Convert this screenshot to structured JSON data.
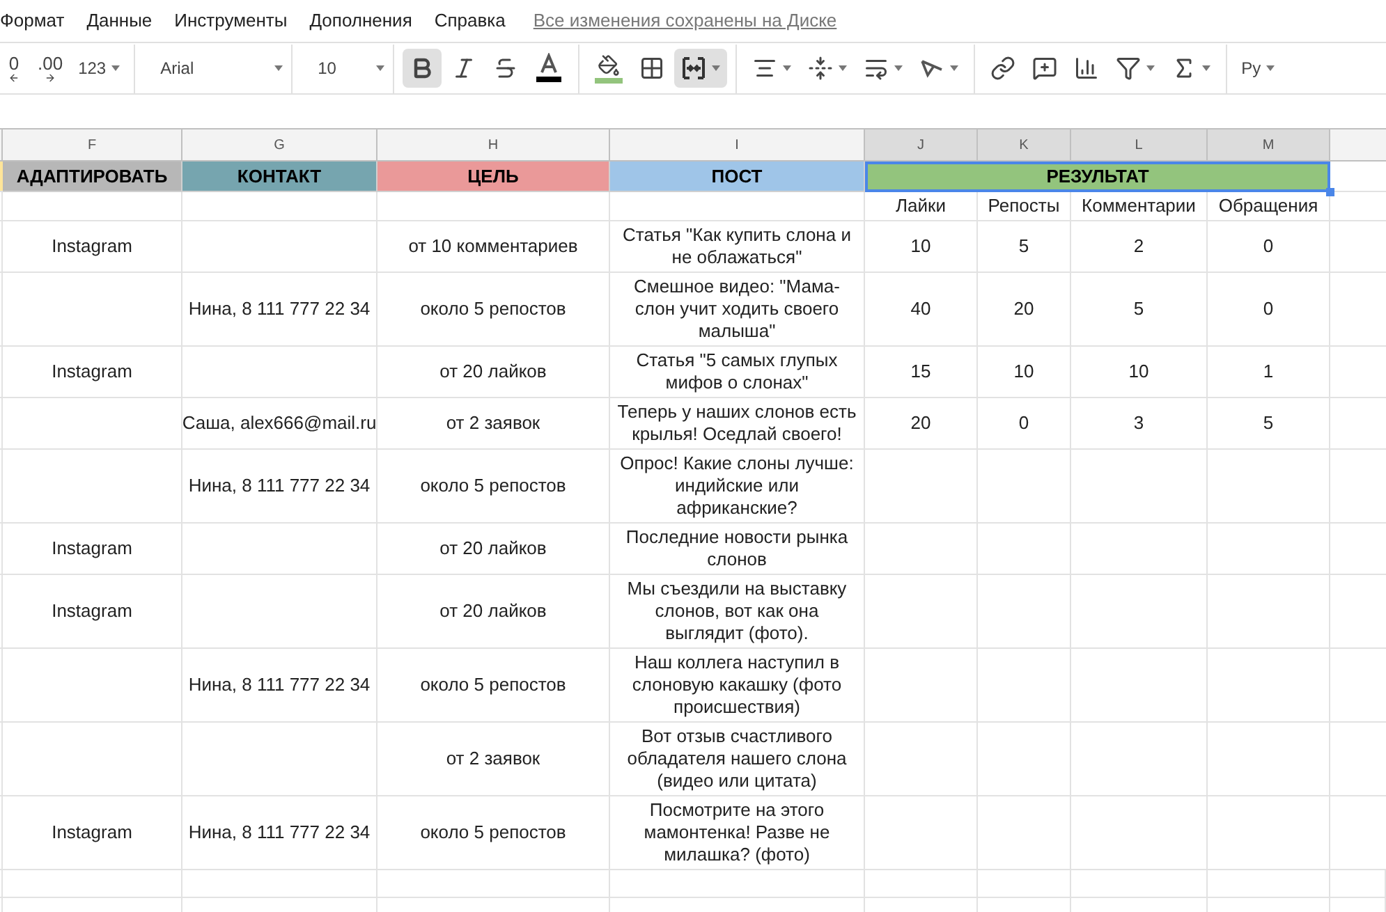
{
  "menu": [
    "Формат",
    "Данные",
    "Инструменты",
    "Дополнения",
    "Справка"
  ],
  "save_status": "Все изменения сохранены на Диске",
  "toolbar": [
    {
      "kind": "decimal",
      "label": "0"
    },
    {
      "kind": "decimal",
      "label": ".00"
    },
    {
      "kind": "dropdown",
      "label": "123"
    },
    {
      "kind": "separator"
    },
    {
      "kind": "dropdown",
      "label": "Arial"
    },
    {
      "kind": "separator"
    },
    {
      "kind": "dropdown",
      "label": "10"
    },
    {
      "kind": "separator"
    },
    {
      "kind": "bold",
      "active": true
    },
    {
      "kind": "italic",
      "active": false
    },
    {
      "kind": "strike",
      "active": false
    },
    {
      "kind": "textcolor",
      "active": false
    },
    {
      "kind": "separator"
    },
    {
      "kind": "fill",
      "active": false
    },
    {
      "kind": "borders",
      "active": false
    },
    {
      "kind": "merge",
      "active": true,
      "caret": true
    },
    {
      "kind": "separator"
    },
    {
      "kind": "halign",
      "active": false,
      "caret": true
    },
    {
      "kind": "valign",
      "active": false,
      "caret": true
    },
    {
      "kind": "wrap",
      "active": false,
      "caret": true
    },
    {
      "kind": "rotate",
      "active": false,
      "caret": true
    },
    {
      "kind": "separator"
    },
    {
      "kind": "link",
      "active": false
    },
    {
      "kind": "comment",
      "active": false
    },
    {
      "kind": "chart",
      "active": false
    },
    {
      "kind": "filter",
      "active": false,
      "caret": true
    },
    {
      "kind": "sigma",
      "active": false,
      "caret": true
    },
    {
      "kind": "separator"
    },
    {
      "kind": "dropdown",
      "label": "Ру"
    }
  ],
  "column_letters": [
    {
      "label": "F",
      "selected": false
    },
    {
      "label": "G",
      "selected": false
    },
    {
      "label": "H",
      "selected": false
    },
    {
      "label": "I",
      "selected": false
    },
    {
      "label": "J",
      "selected": true
    },
    {
      "label": "K",
      "selected": true
    },
    {
      "label": "L",
      "selected": true
    },
    {
      "label": "M",
      "selected": true
    }
  ],
  "header_row": [
    {
      "label": "АДАПТИРОВАТЬ",
      "color": "#b7b7b7"
    },
    {
      "label": "КОНТАКТ",
      "color": "#76a5af"
    },
    {
      "label": "ЦЕЛЬ",
      "color": "#ea9999"
    },
    {
      "label": "ПОСТ",
      "color": "#9fc5e8"
    }
  ],
  "result_header": {
    "label": "РЕЗУЛЬТАТ",
    "color": "#93c47d",
    "selected": true
  },
  "result_columns": [
    "Лайки",
    "Репосты",
    "Комментарии",
    "Обращения"
  ],
  "rows": [
    {
      "F": "Instagram",
      "H": "от 10 комментариев",
      "I": "Статья \"Как купить слона и не облажаться\"",
      "J": "10",
      "K": "5",
      "L": "2",
      "M": "0"
    },
    {
      "G": "Нина, 8 111 777 22 34",
      "H": "около 5 репостов",
      "I": "Смешное видео: \"Мама-слон учит ходить своего малыша\"",
      "J": "40",
      "K": "20",
      "L": "5",
      "M": "0"
    },
    {
      "F": "Instagram",
      "H": "от 20 лайков",
      "I": "Статья \"5 самых глупых мифов о слонах\"",
      "J": "15",
      "K": "10",
      "L": "10",
      "M": "1"
    },
    {
      "G": "Саша, alex666@mail.ru",
      "H": "от 2 заявок",
      "I": "Теперь у наших слонов есть крылья! Оседлай своего!",
      "J": "20",
      "K": "0",
      "L": "3",
      "M": "5"
    },
    {
      "G": "Нина, 8 111 777 22 34",
      "H": "около 5 репостов",
      "I": "Опрос! Какие слоны лучше: индийские или африканские?"
    },
    {
      "F": "Instagram",
      "H": "от 20 лайков",
      "I": "Последние новости рынка слонов"
    },
    {
      "F": "Instagram",
      "H": "от 20 лайков",
      "I": "Мы съездили на выставку слонов, вот как она выглядит (фото)."
    },
    {
      "G": "Нина, 8 111 777 22 34",
      "H": "около 5 репостов",
      "I": "Наш коллега наступил в слоновую какашку (фото происшествия)"
    },
    {
      "H": "от 2 заявок",
      "I": "Вот отзыв счастливого обладателя нашего слона (видео или цитата)"
    },
    {
      "F": "Instagram",
      "G": "Нина, 8 111 777 22 34",
      "H": "около 5 репостов",
      "I": "Посмотрите на этого мамонтенка! Разве не милашка? (фото)"
    }
  ]
}
